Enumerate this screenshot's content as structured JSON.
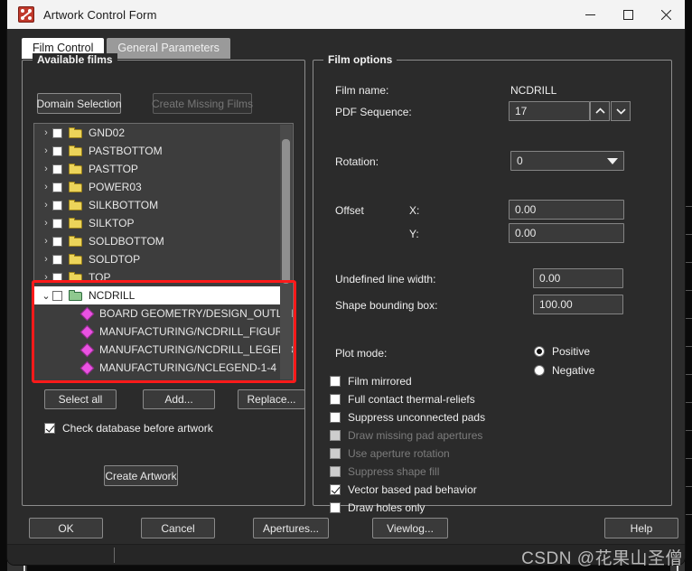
{
  "window": {
    "title": "Artwork Control Form",
    "icon": "allegro-app-icon",
    "controls": {
      "minimize": "minimize-icon",
      "maximize": "maximize-icon",
      "close": "close-icon"
    }
  },
  "tabs": [
    {
      "label": "Film Control",
      "active": true
    },
    {
      "label": "General Parameters",
      "active": false
    }
  ],
  "available_films": {
    "group_title": "Available films",
    "domain_selection_label": "Domain Selection",
    "create_missing_films_label": "Create Missing Films",
    "create_missing_films_disabled": true,
    "tree": [
      {
        "label": "GND02",
        "type": "folder",
        "expanded": false,
        "checked": false,
        "selected": false,
        "icon": "folder-icon"
      },
      {
        "label": "PASTBOTTOM",
        "type": "folder",
        "expanded": false,
        "checked": false,
        "selected": false,
        "icon": "folder-icon"
      },
      {
        "label": "PASTTOP",
        "type": "folder",
        "expanded": false,
        "checked": false,
        "selected": false,
        "icon": "folder-icon"
      },
      {
        "label": "POWER03",
        "type": "folder",
        "expanded": false,
        "checked": false,
        "selected": false,
        "icon": "folder-icon"
      },
      {
        "label": "SILKBOTTOM",
        "type": "folder",
        "expanded": false,
        "checked": false,
        "selected": false,
        "icon": "folder-icon"
      },
      {
        "label": "SILKTOP",
        "type": "folder",
        "expanded": false,
        "checked": false,
        "selected": false,
        "icon": "folder-icon"
      },
      {
        "label": "SOLDBOTTOM",
        "type": "folder",
        "expanded": false,
        "checked": false,
        "selected": false,
        "icon": "folder-icon"
      },
      {
        "label": "SOLDTOP",
        "type": "folder",
        "expanded": false,
        "checked": false,
        "selected": false,
        "icon": "folder-icon"
      },
      {
        "label": "TOP",
        "type": "folder",
        "expanded": false,
        "checked": false,
        "selected": false,
        "icon": "folder-icon"
      },
      {
        "label": "NCDRILL",
        "type": "folder",
        "expanded": true,
        "checked": false,
        "selected": true,
        "icon": "folder-open-icon"
      },
      {
        "label": "BOARD GEOMETRY/DESIGN_OUTLINE",
        "type": "child",
        "icon": "diamond-icon"
      },
      {
        "label": "MANUFACTURING/NCDRILL_FIGURE",
        "type": "child",
        "icon": "diamond-icon"
      },
      {
        "label": "MANUFACTURING/NCDRILL_LEGEND",
        "type": "child",
        "icon": "diamond-icon"
      },
      {
        "label": "MANUFACTURING/NCLEGEND-1-4",
        "type": "child",
        "icon": "diamond-icon"
      }
    ],
    "select_all_label": "Select all",
    "add_label": "Add...",
    "replace_label": "Replace...",
    "check_database_label": "Check database before artwork",
    "check_database_checked": true,
    "create_artwork_label": "Create Artwork"
  },
  "film_options": {
    "group_title": "Film options",
    "film_name_label": "Film name:",
    "film_name_value": "NCDRILL",
    "pdf_sequence_label": "PDF Sequence:",
    "pdf_sequence_value": "17",
    "spinner_up_icon": "chevron-up-icon",
    "spinner_down_icon": "chevron-down-icon",
    "rotation_label": "Rotation:",
    "rotation_value": "0",
    "rotation_caret_icon": "chevron-down-icon",
    "offset_label": "Offset",
    "offset_x_label": "X:",
    "offset_x_value": "0.00",
    "offset_y_label": "Y:",
    "offset_y_value": "0.00",
    "undefined_line_width_label": "Undefined line width:",
    "undefined_line_width_value": "0.00",
    "shape_bounding_box_label": "Shape bounding box:",
    "shape_bounding_box_value": "100.00",
    "plot_mode_label": "Plot mode:",
    "plot_mode_options": [
      {
        "label": "Positive",
        "selected": true
      },
      {
        "label": "Negative",
        "selected": false
      }
    ],
    "checkboxes": [
      {
        "label": "Film mirrored",
        "checked": false,
        "disabled": false
      },
      {
        "label": "Full contact thermal-reliefs",
        "checked": false,
        "disabled": false
      },
      {
        "label": "Suppress unconnected pads",
        "checked": false,
        "disabled": false
      },
      {
        "label": "Draw missing pad apertures",
        "checked": false,
        "disabled": true
      },
      {
        "label": "Use aperture rotation",
        "checked": false,
        "disabled": true
      },
      {
        "label": "Suppress shape fill",
        "checked": false,
        "disabled": true
      },
      {
        "label": "Vector based pad behavior",
        "checked": true,
        "disabled": false
      },
      {
        "label": "Draw holes only",
        "checked": false,
        "disabled": false
      }
    ]
  },
  "bottom_bar": {
    "ok_label": "OK",
    "cancel_label": "Cancel",
    "apertures_label": "Apertures...",
    "viewlog_label": "Viewlog...",
    "help_label": "Help"
  },
  "annotation": {
    "highlight_color": "#ff1a1a"
  },
  "watermark": {
    "text": "CSDN @花果山圣僧"
  }
}
